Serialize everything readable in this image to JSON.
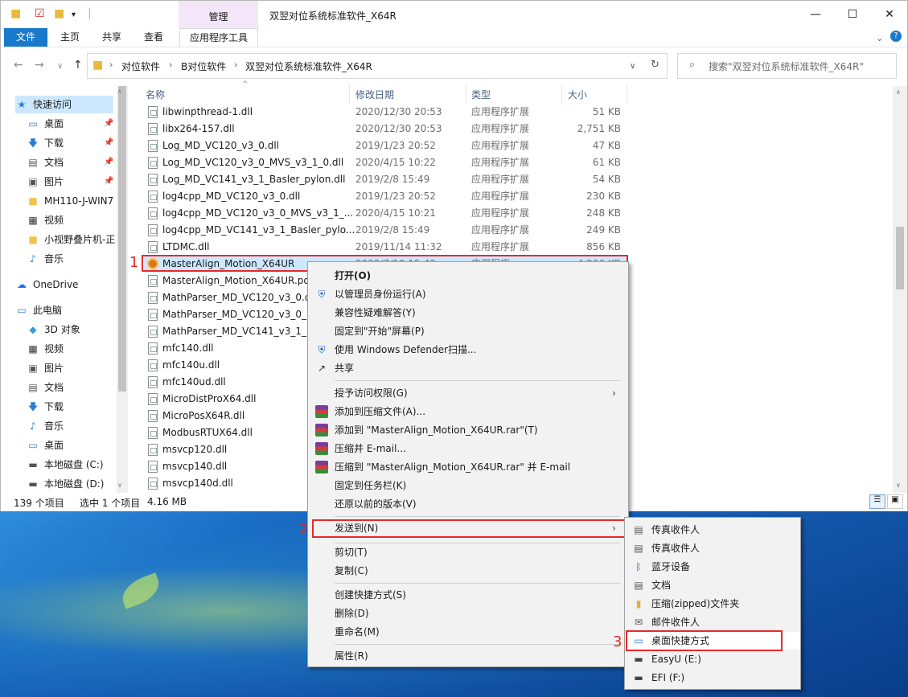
{
  "window": {
    "title": "双翌对位系统标准软件_X64R",
    "manage_tab": "管理",
    "tabs": [
      "文件",
      "主页",
      "共享",
      "查看",
      "应用程序工具"
    ],
    "controls": {
      "minimize": "—",
      "maximize": "☐",
      "close": "✕"
    }
  },
  "address": {
    "crumbs": [
      "对位软件",
      "B对位软件",
      "双翌对位系统标准软件_X64R"
    ],
    "search_placeholder": "搜索\"双翌对位系统标准软件_X64R\""
  },
  "sidebar": [
    {
      "label": "快速访问",
      "icon": "star-icon",
      "glyph": "★",
      "color": "#2b7cd3",
      "selected": true
    },
    {
      "label": "桌面",
      "icon": "desktop-icon",
      "glyph": "▭",
      "color": "#2b7cd3",
      "pinned": true
    },
    {
      "label": "下载",
      "icon": "download-icon",
      "glyph": "🡇",
      "color": "#2b7cd3",
      "pinned": true
    },
    {
      "label": "文档",
      "icon": "document-icon",
      "glyph": "▤",
      "color": "#555",
      "pinned": true
    },
    {
      "label": "图片",
      "icon": "picture-icon",
      "glyph": "▣",
      "color": "#555",
      "pinned": true
    },
    {
      "label": "MH110-J-WIN7",
      "icon": "folder-icon",
      "glyph": "■",
      "color": "#f0c24b"
    },
    {
      "label": "视频",
      "icon": "video-icon",
      "glyph": "▦",
      "color": "#333"
    },
    {
      "label": "小视野叠片机-正",
      "icon": "folder-icon",
      "glyph": "■",
      "color": "#f0c24b"
    },
    {
      "label": "音乐",
      "icon": "music-icon",
      "glyph": "♪",
      "color": "#2b7cd3"
    },
    {
      "label": "OneDrive",
      "icon": "cloud-icon",
      "glyph": "☁",
      "color": "#1a73e8"
    },
    {
      "label": "此电脑",
      "icon": "computer-icon",
      "glyph": "▭",
      "color": "#2b7cd3"
    },
    {
      "label": "3D 对象",
      "icon": "cube-icon",
      "glyph": "◆",
      "color": "#3aa0d8"
    },
    {
      "label": "视频",
      "icon": "video-icon",
      "glyph": "▦",
      "color": "#333"
    },
    {
      "label": "图片",
      "icon": "picture-icon",
      "glyph": "▣",
      "color": "#555"
    },
    {
      "label": "文档",
      "icon": "document-icon",
      "glyph": "▤",
      "color": "#555"
    },
    {
      "label": "下载",
      "icon": "download-icon",
      "glyph": "🡇",
      "color": "#2b7cd3"
    },
    {
      "label": "音乐",
      "icon": "music-icon",
      "glyph": "♪",
      "color": "#2b7cd3"
    },
    {
      "label": "桌面",
      "icon": "desktop-icon",
      "glyph": "▭",
      "color": "#2b7cd3"
    },
    {
      "label": "本地磁盘 (C:)",
      "icon": "drive-icon",
      "glyph": "▬",
      "color": "#555"
    },
    {
      "label": "本地磁盘 (D:)",
      "icon": "drive-icon",
      "glyph": "▬",
      "color": "#555"
    }
  ],
  "columns": {
    "name": "名称",
    "date": "修改日期",
    "type": "类型",
    "size": "大小"
  },
  "files": [
    {
      "name": "libwinpthread-1.dll",
      "date": "2020/12/30 20:53",
      "type": "应用程序扩展",
      "size": "51 KB"
    },
    {
      "name": "libx264-157.dll",
      "date": "2020/12/30 20:53",
      "type": "应用程序扩展",
      "size": "2,751 KB"
    },
    {
      "name": "Log_MD_VC120_v3_0.dll",
      "date": "2019/1/23 20:52",
      "type": "应用程序扩展",
      "size": "47 KB"
    },
    {
      "name": "Log_MD_VC120_v3_0_MVS_v3_1_0.dll",
      "date": "2020/4/15 10:22",
      "type": "应用程序扩展",
      "size": "61 KB"
    },
    {
      "name": "Log_MD_VC141_v3_1_Basler_pylon.dll",
      "date": "2019/2/8 15:49",
      "type": "应用程序扩展",
      "size": "54 KB"
    },
    {
      "name": "log4cpp_MD_VC120_v3_0.dll",
      "date": "2019/1/23 20:52",
      "type": "应用程序扩展",
      "size": "230 KB"
    },
    {
      "name": "log4cpp_MD_VC120_v3_0_MVS_v3_1_...",
      "date": "2020/4/15 10:21",
      "type": "应用程序扩展",
      "size": "248 KB"
    },
    {
      "name": "log4cpp_MD_VC141_v3_1_Basler_pylo...",
      "date": "2019/2/8 15:49",
      "type": "应用程序扩展",
      "size": "249 KB"
    },
    {
      "name": "LTDMC.dll",
      "date": "2019/11/14 11:32",
      "type": "应用程序扩展",
      "size": "856 KB"
    },
    {
      "name": "MasterAlign_Motion_X64UR",
      "date": "2022/7/19 15:42",
      "type": "应用程序",
      "size": "4,266 KB",
      "selected": true
    },
    {
      "name": "MasterAlign_Motion_X64UR.pdb",
      "date": "",
      "type": "",
      "size": ""
    },
    {
      "name": "MathParser_MD_VC120_v3_0.dll",
      "date": "",
      "type": "",
      "size": ""
    },
    {
      "name": "MathParser_MD_VC120_v3_0_M",
      "date": "",
      "type": "",
      "size": ""
    },
    {
      "name": "MathParser_MD_VC141_v3_1_Ba",
      "date": "",
      "type": "",
      "size": ""
    },
    {
      "name": "mfc140.dll",
      "date": "",
      "type": "",
      "size": ""
    },
    {
      "name": "mfc140u.dll",
      "date": "",
      "type": "",
      "size": ""
    },
    {
      "name": "mfc140ud.dll",
      "date": "",
      "type": "",
      "size": ""
    },
    {
      "name": "MicroDistProX64.dll",
      "date": "",
      "type": "",
      "size": ""
    },
    {
      "name": "MicroPosX64R.dll",
      "date": "",
      "type": "",
      "size": ""
    },
    {
      "name": "ModbusRTUX64.dll",
      "date": "",
      "type": "",
      "size": ""
    },
    {
      "name": "msvcp120.dll",
      "date": "",
      "type": "",
      "size": ""
    },
    {
      "name": "msvcp140.dll",
      "date": "",
      "type": "",
      "size": ""
    },
    {
      "name": "msvcp140d.dll",
      "date": "",
      "type": "",
      "size": ""
    }
  ],
  "status": {
    "count": "139 个项目",
    "selection": "选中 1 个项目",
    "size": "4.16 MB"
  },
  "context_menu": [
    {
      "label": "打开(O)",
      "bold": true,
      "icon": "",
      "glyph": ""
    },
    {
      "label": "以管理员身份运行(A)",
      "icon": "uac-shield-icon",
      "glyph": "⛨",
      "color": "#2b6cc4"
    },
    {
      "label": "兼容性疑难解答(Y)"
    },
    {
      "label": "固定到\"开始\"屏幕(P)"
    },
    {
      "label": "使用 Windows Defender扫描...",
      "icon": "defender-icon",
      "glyph": "⛨",
      "color": "#1565c0"
    },
    {
      "label": "共享",
      "icon": "share-icon",
      "glyph": "↗",
      "color": "#333"
    },
    {
      "sep": true
    },
    {
      "label": "授予访问权限(G)",
      "submenu": true
    },
    {
      "label": "添加到压缩文件(A)...",
      "icon": "winrar-icon",
      "rar": true
    },
    {
      "label": "添加到 \"MasterAlign_Motion_X64UR.rar\"(T)",
      "icon": "winrar-icon",
      "rar": true
    },
    {
      "label": "压缩并 E-mail...",
      "icon": "winrar-icon",
      "rar": true
    },
    {
      "label": "压缩到 \"MasterAlign_Motion_X64UR.rar\" 并 E-mail",
      "icon": "winrar-icon",
      "rar": true
    },
    {
      "label": "固定到任务栏(K)"
    },
    {
      "label": "还原以前的版本(V)"
    },
    {
      "sep": true
    },
    {
      "label": "发送到(N)",
      "submenu": true,
      "highlight": true
    },
    {
      "sep": true
    },
    {
      "label": "剪切(T)"
    },
    {
      "label": "复制(C)"
    },
    {
      "sep": true
    },
    {
      "label": "创建快捷方式(S)"
    },
    {
      "label": "删除(D)"
    },
    {
      "label": "重命名(M)"
    },
    {
      "sep": true
    },
    {
      "label": "属性(R)"
    }
  ],
  "sendto_menu": [
    {
      "label": "传真收件人",
      "icon": "fax-icon",
      "glyph": "▤",
      "color": "#555"
    },
    {
      "label": "传真收件人",
      "icon": "fax-icon",
      "glyph": "▤",
      "color": "#555"
    },
    {
      "label": "蓝牙设备",
      "icon": "bluetooth-icon",
      "glyph": "ᛒ",
      "color": "#1565c0"
    },
    {
      "label": "文档",
      "icon": "document-icon",
      "glyph": "▤",
      "color": "#555"
    },
    {
      "label": "压缩(zipped)文件夹",
      "icon": "zip-folder-icon",
      "glyph": "▮",
      "color": "#e0b23a"
    },
    {
      "label": "邮件收件人",
      "icon": "mail-icon",
      "glyph": "✉",
      "color": "#555"
    },
    {
      "label": "桌面快捷方式",
      "icon": "desktop-icon",
      "glyph": "▭",
      "color": "#2b7cd3",
      "highlight": true
    },
    {
      "label": "EasyU (E:)",
      "icon": "drive-icon",
      "glyph": "▬",
      "color": "#444"
    },
    {
      "label": "EFI (F:)",
      "icon": "drive-icon",
      "glyph": "▬",
      "color": "#444"
    }
  ],
  "markers": [
    "1",
    "2",
    "3"
  ],
  "colors": {
    "accent": "#1979ca",
    "selection": "#cce8ff",
    "annotation": "#e8292a",
    "menu_bg": "#f2f2f2"
  }
}
